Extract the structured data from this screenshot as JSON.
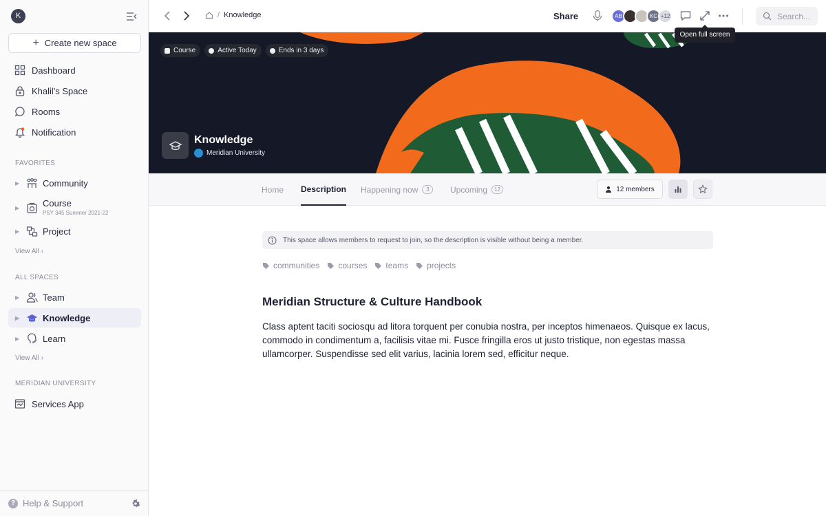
{
  "sidebar": {
    "workspace_initial": "K",
    "create_label": "Create new space",
    "nav": [
      {
        "label": "Dashboard",
        "icon": "grid-icon"
      },
      {
        "label": "Khalil's Space",
        "icon": "lock-icon"
      },
      {
        "label": "Rooms",
        "icon": "chat-icon"
      },
      {
        "label": "Notification",
        "icon": "bell-icon"
      }
    ],
    "favorites_label": "FAVORITES",
    "favorites": [
      {
        "label": "Community",
        "icon": "people-icon"
      },
      {
        "label": "Course",
        "sub": "PSY 345 Summer 2021-22",
        "icon": "camera-icon"
      },
      {
        "label": "Project",
        "icon": "project-icon"
      }
    ],
    "view_all_label": "View All",
    "all_spaces_label": "ALL SPACES",
    "spaces": [
      {
        "label": "Team",
        "icon": "team-icon"
      },
      {
        "label": "Knowledge",
        "icon": "graduation-cap-icon",
        "active": true
      },
      {
        "label": "Learn",
        "icon": "head-icon"
      }
    ],
    "org_label": "MERIDIAN UNIVERSITY",
    "org_apps": [
      {
        "label": "Services App",
        "icon": "app-icon"
      }
    ],
    "help_label": "Help & Support"
  },
  "topbar": {
    "breadcrumb": "Knowledge",
    "share_label": "Share",
    "avatars": [
      {
        "initials": "AB",
        "color": "#6b6fd6"
      },
      {
        "initials": "",
        "color": "#3a3030"
      },
      {
        "initials": "",
        "color": "#c9c2bd"
      },
      {
        "initials": "KC",
        "color": "#6e7389"
      },
      {
        "initials": "+12",
        "color": "#d9dae2"
      }
    ],
    "tooltip": "Open full screen",
    "search_placeholder": "Search..."
  },
  "banner": {
    "chips": [
      "Course",
      "Active Today",
      "Ends in 3 days"
    ],
    "title": "Knowledge",
    "org": "Meridian University",
    "colors": {
      "bg": "#141827",
      "orange": "#f26b1d",
      "green": "#1f5c35",
      "stripe": "#ffffff"
    }
  },
  "tabs": [
    {
      "label": "Home"
    },
    {
      "label": "Description",
      "active": true
    },
    {
      "label": "Happening now",
      "count": "3"
    },
    {
      "label": "Upcoming",
      "count": "12"
    }
  ],
  "members_label": "12 members",
  "notice": "This space allows members to request to join, so the description is visible without being a member.",
  "tags": [
    "communities",
    "courses",
    "teams",
    "projects"
  ],
  "document": {
    "title": "Meridian Structure & Culture Handbook",
    "body": "Class aptent taciti sociosqu ad litora torquent per conubia nostra, per inceptos himenaeos. Quisque ex lacus, commodo in condimentum a, facilisis vitae mi. Fusce fringilla eros ut justo tristique, non egestas massa ullamcorper. Suspendisse sed elit varius, lacinia lorem sed, efficitur neque."
  }
}
